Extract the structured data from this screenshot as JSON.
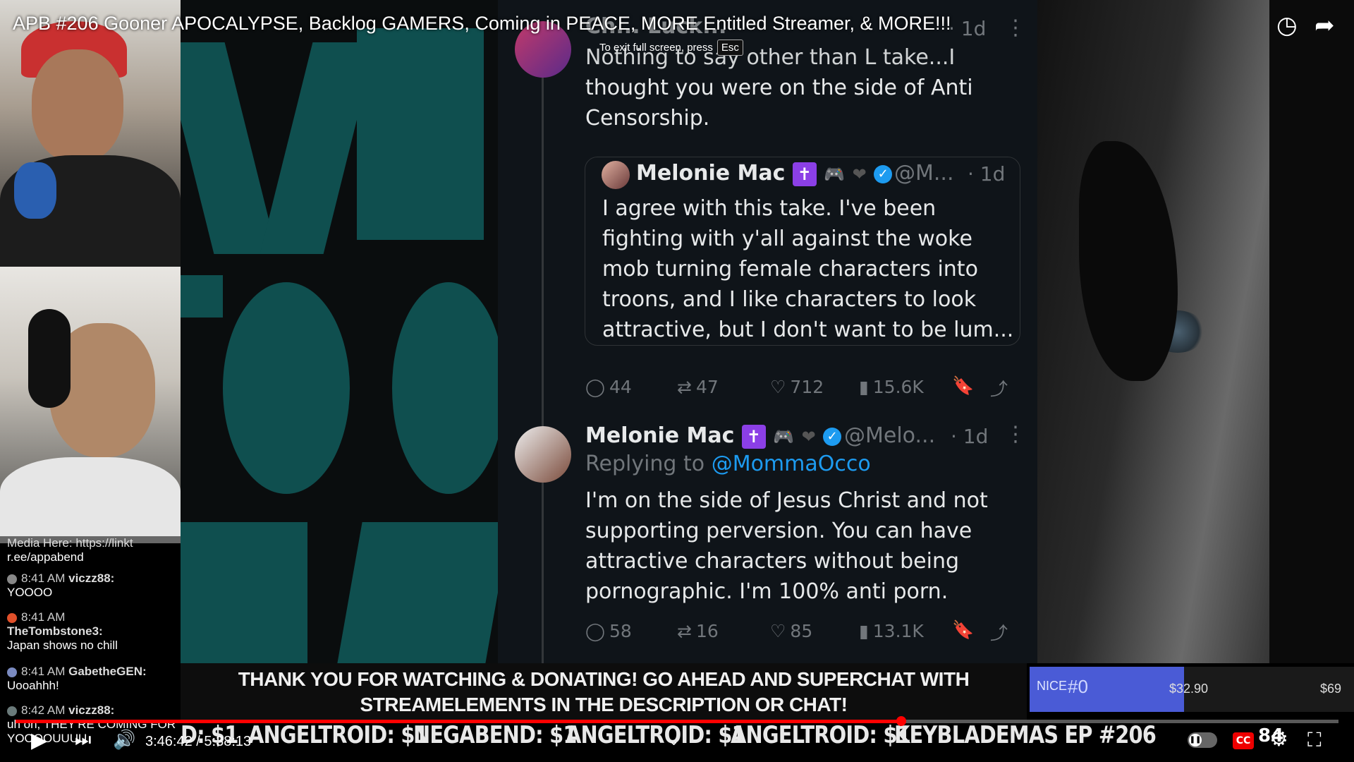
{
  "video": {
    "title": "APB #206 Gooner APOCALYPSE, Backlog GAMERS, Coming in PEACE, MORE Entitled Streamer, & MORE!!!",
    "fullscreen_tip": "To exit full screen, press",
    "fullscreen_key": "Esc",
    "time_current": "3:46:42",
    "time_separator": "/",
    "time_total": "5:38:13",
    "progress": 0.6696
  },
  "tweets": {
    "top": {
      "name_partial": "Ch... Luck...",
      "time": "· 1d",
      "lines": [
        "Nothing to say other than L take...I",
        "thought you were on the side of Anti",
        "Censorship."
      ]
    },
    "quote": {
      "name": "Melonie Mac",
      "handle": "@M...",
      "time": "· 1d",
      "lines": [
        "I agree with this take. I've been",
        "fighting with y'all against the woke",
        "mob turning female characters into",
        "troons, and I like characters to look",
        "attractive, but I don't want to be lum..."
      ]
    },
    "top_metrics": {
      "replies": "44",
      "reposts": "47",
      "likes": "712",
      "views": "15.6K"
    },
    "reply": {
      "name": "Melonie Mac",
      "handle": "@Melo...",
      "time": "· 1d",
      "replying_prefix": "Replying to",
      "replying_handle": "@MommaOcco",
      "lines": [
        "I'm on the side of Jesus Christ and not",
        "supporting perversion. You can have",
        "attractive characters without being",
        "pornographic. I'm 100% anti porn."
      ]
    },
    "reply_metrics": {
      "replies": "58",
      "reposts": "16",
      "likes": "85",
      "views": "13.1K"
    }
  },
  "chat": [
    {
      "text": "Media Here: https://linkt"
    },
    {
      "text": "r.ee/appabend"
    },
    {
      "time": "8:41 AM",
      "user": "viczz88:",
      "msg": "YOOOO"
    },
    {
      "time": "8:41 AM",
      "user": "TheTombstone3:",
      "msg": "Japan shows no chill"
    },
    {
      "time": "8:41 AM",
      "user": "GabetheGEN:",
      "msg": "Uooahhh!"
    },
    {
      "time": "8:42 AM",
      "user": "viczz88:",
      "msg": "uh oh, THEY'RE COMING FOR YOOOOUUUU"
    }
  ],
  "banner": {
    "line1": "THANK YOU FOR WATCHING & DONATING! GO AHEAD AND SUPERCHAT WITH",
    "line2": "STREAMELEMENTS IN THE DESCRIPTION OR CHAT!"
  },
  "goal": {
    "label": "NICE",
    "number": "#0",
    "current": "$32.90",
    "target": "$69",
    "fraction": 0.477
  },
  "ticker": [
    "D: $1",
    "ANGELTROID: $1",
    "NEGABEND: $1",
    "ANGELTROID: $1",
    "ANGELTROID: $1",
    "KEYBLADEMAS EP #206"
  ],
  "controls": {
    "quality_partial": "84",
    "cc": "CC"
  },
  "icons": {
    "watch_later": "clock-icon",
    "share": "share-icon",
    "play": "play-icon",
    "next": "next-icon",
    "volume": "volume-icon",
    "settings": "gear-icon",
    "exit_fullscreen": "exit-fullscreen-icon",
    "reply": "reply-icon",
    "repost": "repost-icon",
    "like": "heart-icon",
    "views": "views-icon",
    "bookmark": "bookmark-icon",
    "share_tweet": "share-icon"
  },
  "colors": {
    "tweet_bg": "#0f1419",
    "verified": "#1d9bf0",
    "link": "#1d9bf0",
    "progress": "#ff0000",
    "goal_fill": "#4a5bd6"
  }
}
